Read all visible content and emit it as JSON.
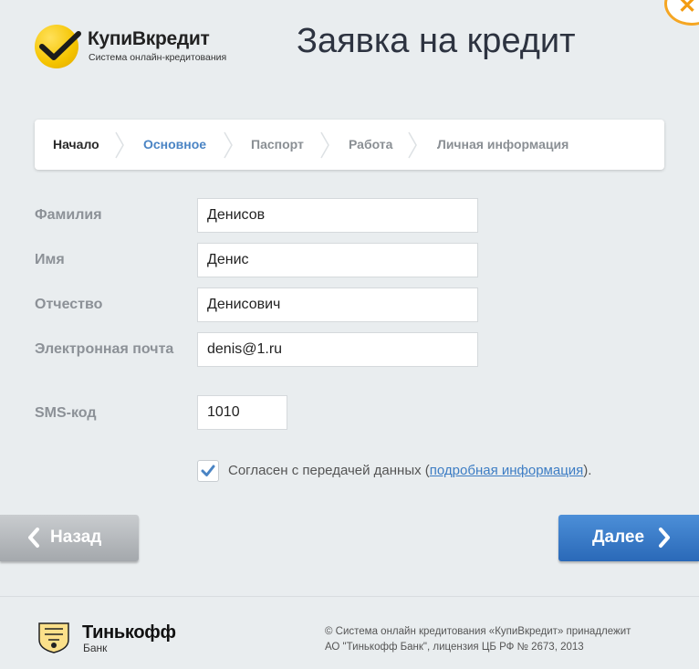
{
  "header": {
    "brand_name": "КупиВкредит",
    "brand_tagline": "Система онлайн-кредитования",
    "title": "Заявка на кредит"
  },
  "steps": [
    {
      "label": "Начало",
      "state": "done"
    },
    {
      "label": "Основное",
      "state": "active"
    },
    {
      "label": "Паспорт",
      "state": "pending"
    },
    {
      "label": "Работа",
      "state": "pending"
    },
    {
      "label": "Личная информация",
      "state": "pending"
    }
  ],
  "form": {
    "last_name": {
      "label": "Фамилия",
      "value": "Денисов"
    },
    "first_name": {
      "label": "Имя",
      "value": "Денис"
    },
    "middle_name": {
      "label": "Отчество",
      "value": "Денисович"
    },
    "email": {
      "label": "Электронная почта",
      "value": "denis@1.ru"
    },
    "sms_code": {
      "label": "SMS-код",
      "value": "1010"
    },
    "consent": {
      "checked": true,
      "text_before": "Согласен с передачей данных (",
      "link": "подробная информация",
      "text_after": ")."
    }
  },
  "buttons": {
    "back": "Назад",
    "next": "Далее"
  },
  "footer": {
    "bank_name": "Тинькофф",
    "bank_sub": "Банк",
    "copyright_line1": "© Система онлайн кредитования «КупиВкредит» принадлежит",
    "copyright_line2": "АО \"Тинькофф Банк\", лицензия ЦБ РФ № 2673, 2013"
  },
  "colors": {
    "accent": "#2f72c2",
    "brand_yellow": "#f5c400",
    "active_step": "#4a84c4"
  }
}
